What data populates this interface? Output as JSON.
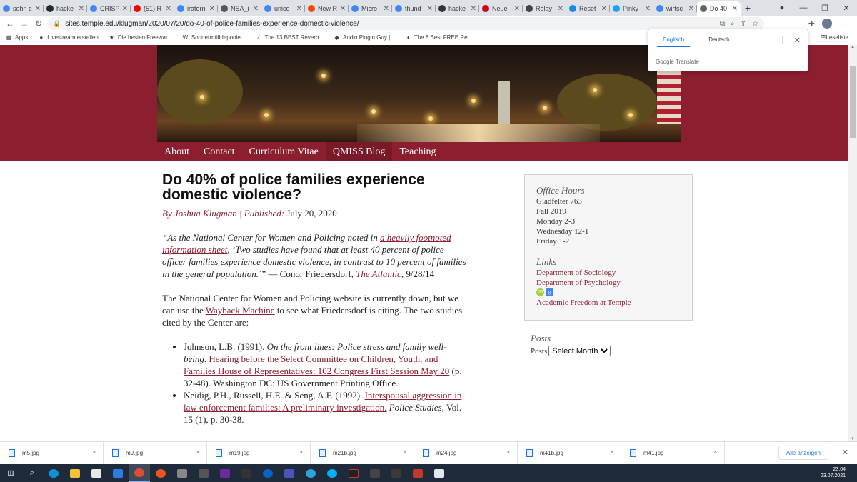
{
  "browser": {
    "tabs": [
      {
        "title": "sohn c",
        "color": "#4285f4"
      },
      {
        "title": "hacke",
        "color": "#24292e"
      },
      {
        "title": "CRISP",
        "color": "#4285f4"
      },
      {
        "title": "(51) R",
        "color": "#ff0000"
      },
      {
        "title": "iratern",
        "color": "#4285f4"
      },
      {
        "title": "NSA_i",
        "color": "#555555"
      },
      {
        "title": "unico",
        "color": "#4285f4"
      },
      {
        "title": "New R",
        "color": "#ff4500"
      },
      {
        "title": "Micro",
        "color": "#4285f4"
      },
      {
        "title": "thund",
        "color": "#4285f4"
      },
      {
        "title": "hacke",
        "color": "#333333"
      },
      {
        "title": "Neue",
        "color": "#d0021b"
      },
      {
        "title": "Relay",
        "color": "#444444"
      },
      {
        "title": "Reset",
        "color": "#1e88e5"
      },
      {
        "title": "Pinky",
        "color": "#1da1f2"
      },
      {
        "title": "wirtsc",
        "color": "#4285f4"
      },
      {
        "title": "Do 40",
        "color": "#5f6368"
      }
    ],
    "new_tab": "+",
    "url": "sites.temple.edu/klugman/2020/07/20/do-40-of-police-families-experience-domestic-violence/",
    "bookmarks": [
      {
        "label": "Apps",
        "icon": "apps-grid-icon",
        "glyph": "▦"
      },
      {
        "label": "Livestream erstellen",
        "icon": "globe-icon",
        "glyph": "●"
      },
      {
        "label": "Die besten Freewar...",
        "icon": "star-icon",
        "glyph": "★"
      },
      {
        "label": "Sondermülldeponie...",
        "icon": "w-icon",
        "glyph": "W"
      },
      {
        "label": "The 13 BEST Reverb...",
        "icon": "plugin-icon",
        "glyph": "∕"
      },
      {
        "label": "Audio Plugin Guy |...",
        "icon": "plugin-guy-icon",
        "glyph": "◆"
      },
      {
        "label": "The 8 Best FREE Re...",
        "icon": "leaf-icon",
        "glyph": "◖"
      }
    ],
    "reading_list": "Leseliste"
  },
  "translate": {
    "lang_from": "Englisch",
    "lang_to": "Deutsch",
    "brand": "Google Translate"
  },
  "site": {
    "nav": [
      "About",
      "Contact",
      "Curriculum Vitae",
      "QMISS Blog",
      "Teaching"
    ]
  },
  "article": {
    "title": "Do 40% of police families experience domestic violence?",
    "byline_prefix": "By Joshua Klugman | Published: ",
    "date": "July 20, 2020",
    "quote_open": "“As the National Center for Women and Policing noted in ",
    "quote_link": "a heavily footnoted information sheet",
    "quote_rest": ", ‘Two studies have found that at least 40 percent of police officer families experience domestic violence, in contrast to 10 percent of families in the general population.’",
    "quote_attrib": "” — Conor Friedersdorf, ",
    "quote_source": "The Atlantic",
    "quote_date": ", 9/28/14",
    "p2_a": "The National Center for Women and Policing website is currently down, but we can use the ",
    "p2_link": "Wayback Machine",
    "p2_b": " to see what Friedersdorf is citing.  The two studies cited by the Center are:",
    "ref1_a": " Johnson, L.B. (1991). ",
    "ref1_italic": "On the front lines: Police stress and family well-being",
    "ref1_b": ". ",
    "ref1_link": "Hearing before the Select Committee on Children, Youth, and Families House of Representatives: 102 Congress First Session May 20",
    "ref1_c": " (p. 32-48). Washington DC: US Government Printing Office.",
    "ref2_a": "Neidig, P.H., Russell, H.E. & Seng, A.F. (1992). ",
    "ref2_link": "Interspousal aggression in law enforcement families: A preliminary investigation.",
    "ref2_b": " ",
    "ref2_italic": "Police Studies",
    "ref2_c": ", Vol. 15 (1), p. 30-38."
  },
  "sidebar": {
    "office_title": "Office Hours",
    "office_lines": [
      "Gladfelter 763",
      "Fall 2019",
      "Monday 2-3",
      "Wednesday 12-1",
      "Friday 1-2"
    ],
    "links_title": "Links",
    "links": [
      "Department of Sociology",
      "Department of Psychology"
    ],
    "badges": [
      "iD",
      "g"
    ],
    "link_extra": "Academic Freedom at Temple",
    "posts_title": "Posts",
    "posts_label": "Posts",
    "posts_select": "Select Month"
  },
  "downloads": {
    "files": [
      "m5.jpg",
      "m9.jpg",
      "m19.jpg",
      "m21b.jpg",
      "m24.jpg",
      "m41b.jpg",
      "m41.jpg"
    ],
    "show_all": "Alle anzeigen"
  },
  "taskbar": {
    "time": "23:04",
    "date": "23.07.2021"
  }
}
